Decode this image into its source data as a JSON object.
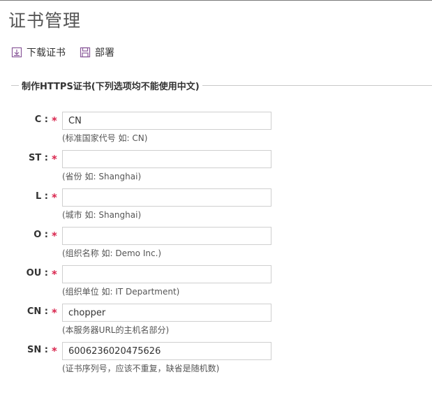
{
  "page": {
    "title": "证书管理"
  },
  "toolbar": {
    "download_label": "下载证书",
    "deploy_label": "部署"
  },
  "form": {
    "legend": "制作HTTPS证书(下列选项均不能使用中文)",
    "required_mark": "*",
    "fields": [
      {
        "label": "C :",
        "value": "CN",
        "hint": "(标准国家代号 如: CN)"
      },
      {
        "label": "ST :",
        "value": "",
        "hint": "(省份 如: Shanghai)"
      },
      {
        "label": "L :",
        "value": "",
        "hint": "(城市 如: Shanghai)"
      },
      {
        "label": "O :",
        "value": "",
        "hint": "(组织名称 如: Demo Inc.)"
      },
      {
        "label": "OU :",
        "value": "",
        "hint": "(组织单位 如: IT Department)"
      },
      {
        "label": "CN :",
        "value": "chopper",
        "hint": "(本服务器URL的主机名部分)"
      },
      {
        "label": "SN :",
        "value": "6006236020475626",
        "hint": "(证书序列号，应该不重复，缺省是随机数)"
      }
    ]
  },
  "colors": {
    "required": "#d9254d",
    "icon": "#8a5a9a"
  }
}
